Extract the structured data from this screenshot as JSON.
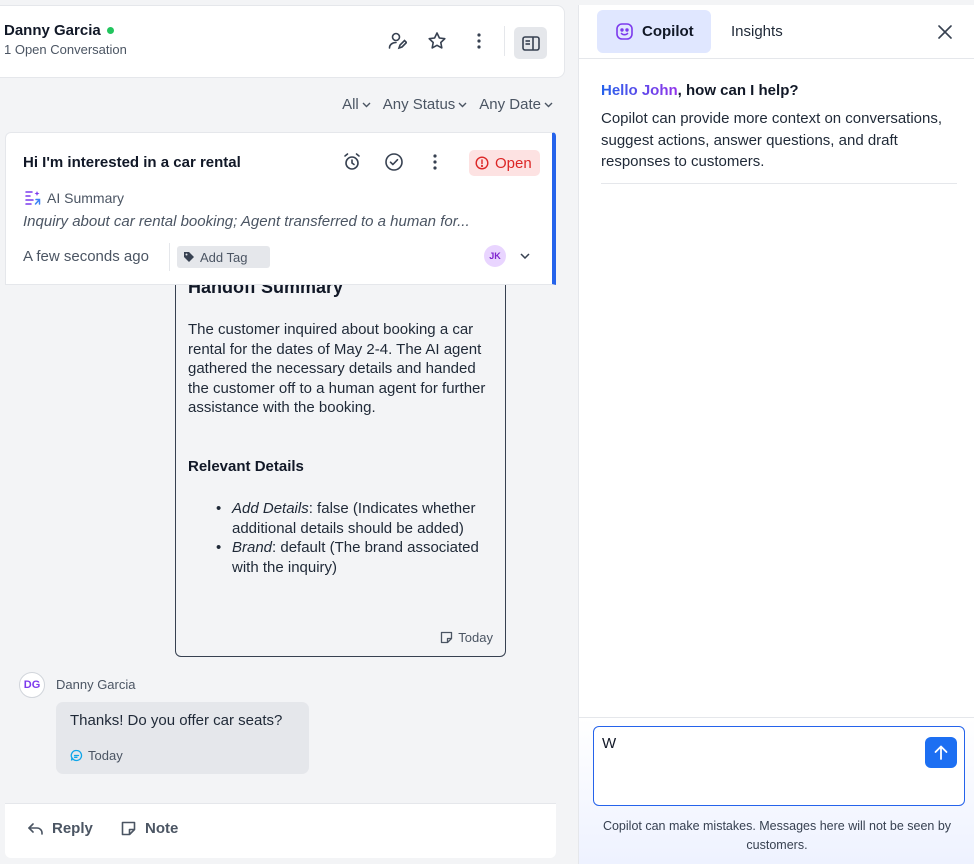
{
  "contact": {
    "name": "Danny Garcia",
    "subtitle": "1 Open Conversation",
    "status_color": "#22c55e"
  },
  "header_icons": [
    "assign-agent-icon",
    "star-icon",
    "more-vertical-icon",
    "panel-toggle-icon"
  ],
  "filters": [
    {
      "label": "All"
    },
    {
      "label": "Any Status"
    },
    {
      "label": "Any Date"
    }
  ],
  "conversation": {
    "title": "Hi I'm interested in a car rental",
    "status": "Open",
    "ai_summary_label": "AI Summary",
    "summary": "Inquiry about car rental booking; Agent transferred to a human for...",
    "time": "A few seconds ago",
    "add_tag": "Add Tag",
    "assignee_initials": "JK"
  },
  "handoff_note": {
    "title": "Handoff Summary",
    "body": "The customer inquired about booking a car rental for the dates of May 2-4. The AI agent gathered the necessary details and handed the customer off to a human agent for further assistance with the booking.",
    "details_title": "Relevant Details",
    "details": [
      {
        "key": "Add Details",
        "value": ": false (Indicates whether additional details should be added)"
      },
      {
        "key": "Brand",
        "value": ": default (The brand associated with the inquiry)"
      }
    ],
    "time": "Today"
  },
  "message": {
    "sender_initials": "DG",
    "sender_name": "Danny Garcia",
    "text": "Thanks! Do you offer car seats?",
    "time": "Today"
  },
  "compose": {
    "reply_label": "Reply",
    "note_label": "Note"
  },
  "copilot": {
    "tabs": [
      {
        "label": "Copilot",
        "active": true
      },
      {
        "label": "Insights",
        "active": false
      }
    ],
    "greeting_name": "Hello John",
    "greeting_rest": ", how can I help?",
    "intro": "Copilot can provide more context on conversations, suggest actions, answer questions, and draft responses to customers.",
    "input_value": "W",
    "disclaimer": "Copilot can make mistakes. Messages here will not be seen by customers."
  },
  "colors": {
    "accent": "#1d6ff2",
    "open_badge": "#dc2626",
    "active_card_border": "#2563eb"
  }
}
